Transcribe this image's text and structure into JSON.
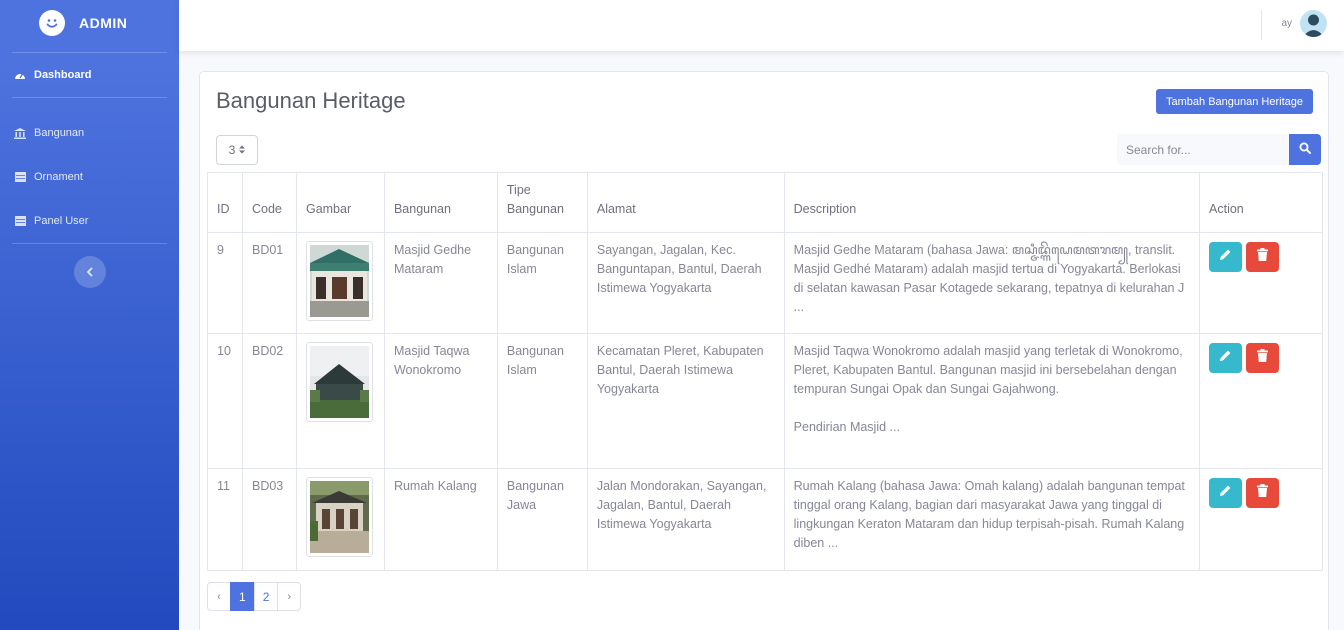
{
  "sidebar": {
    "brand": "ADMIN",
    "items": [
      {
        "label": "Dashboard",
        "icon": "dashboard-icon"
      },
      {
        "label": "Bangunan",
        "icon": "building-icon"
      },
      {
        "label": "Ornament",
        "icon": "table-icon"
      },
      {
        "label": "Panel User",
        "icon": "table-icon"
      }
    ]
  },
  "topbar": {
    "username": "ay"
  },
  "page": {
    "title": "Bangunan Heritage",
    "add_button": "Tambah Bangunan Heritage",
    "per_page": "3",
    "search_placeholder": "Search for..."
  },
  "table": {
    "headers": [
      "ID",
      "Code",
      "Gambar",
      "Bangunan",
      "Tipe Bangunan",
      "Alamat",
      "Description",
      "Action"
    ],
    "rows": [
      {
        "id": "9",
        "code": "BD01",
        "bangunan": "Masjid Gedhe Mataram",
        "tipe": "Bangunan Islam",
        "alamat": "Sayangan, Jagalan, Kec. Banguntapan, Bantul, Daerah Istimewa Yogyakarta",
        "description": "Masjid Gedhe Mataram (bahasa Jawa: ꦩꦱ꧀ꦗꦶꦢ꧀ꦒꦼꦝꦺꦩꦠꦫꦩ꧀, translit. Masjid Gedhé Mataram) adalah masjid tertua di Yogyakarta. Berlokasi di selatan kawasan Pasar Kotagede sekarang, tepatnya di kelurahan J ...",
        "description_extra": ""
      },
      {
        "id": "10",
        "code": "BD02",
        "bangunan": "Masjid Taqwa Wonokromo",
        "tipe": "Bangunan Islam",
        "alamat": "Kecamatan Pleret, Kabupaten Bantul, Daerah Istimewa Yogyakarta",
        "description": "Masjid Taqwa Wonokromo adalah masjid yang terletak di Wonokromo, Pleret, Kabupaten Bantul. Bangunan masjid ini bersebelahan dengan tempuran Sungai Opak dan Sungai Gajahwong.",
        "description_extra": "Pendirian Masjid ..."
      },
      {
        "id": "11",
        "code": "BD03",
        "bangunan": "Rumah Kalang",
        "tipe": "Bangunan Jawa",
        "alamat": "Jalan Mondorakan, Sayangan, Jagalan, Bantul, Daerah Istimewa Yogyakarta",
        "description": "Rumah Kalang (bahasa Jawa: Omah kalang) adalah bangunan tempat tinggal orang Kalang, bagian dari masyarakat Jawa yang tinggal di lingkungan Keraton Mataram dan hidup terpisah-pisah. Rumah Kalang diben ...",
        "description_extra": ""
      }
    ]
  },
  "pagination": {
    "prev": "‹",
    "pages": [
      "1",
      "2"
    ],
    "next": "›",
    "active": "1"
  },
  "colors": {
    "primary": "#4e73df",
    "info": "#36b9cc",
    "danger": "#e74a3b"
  }
}
